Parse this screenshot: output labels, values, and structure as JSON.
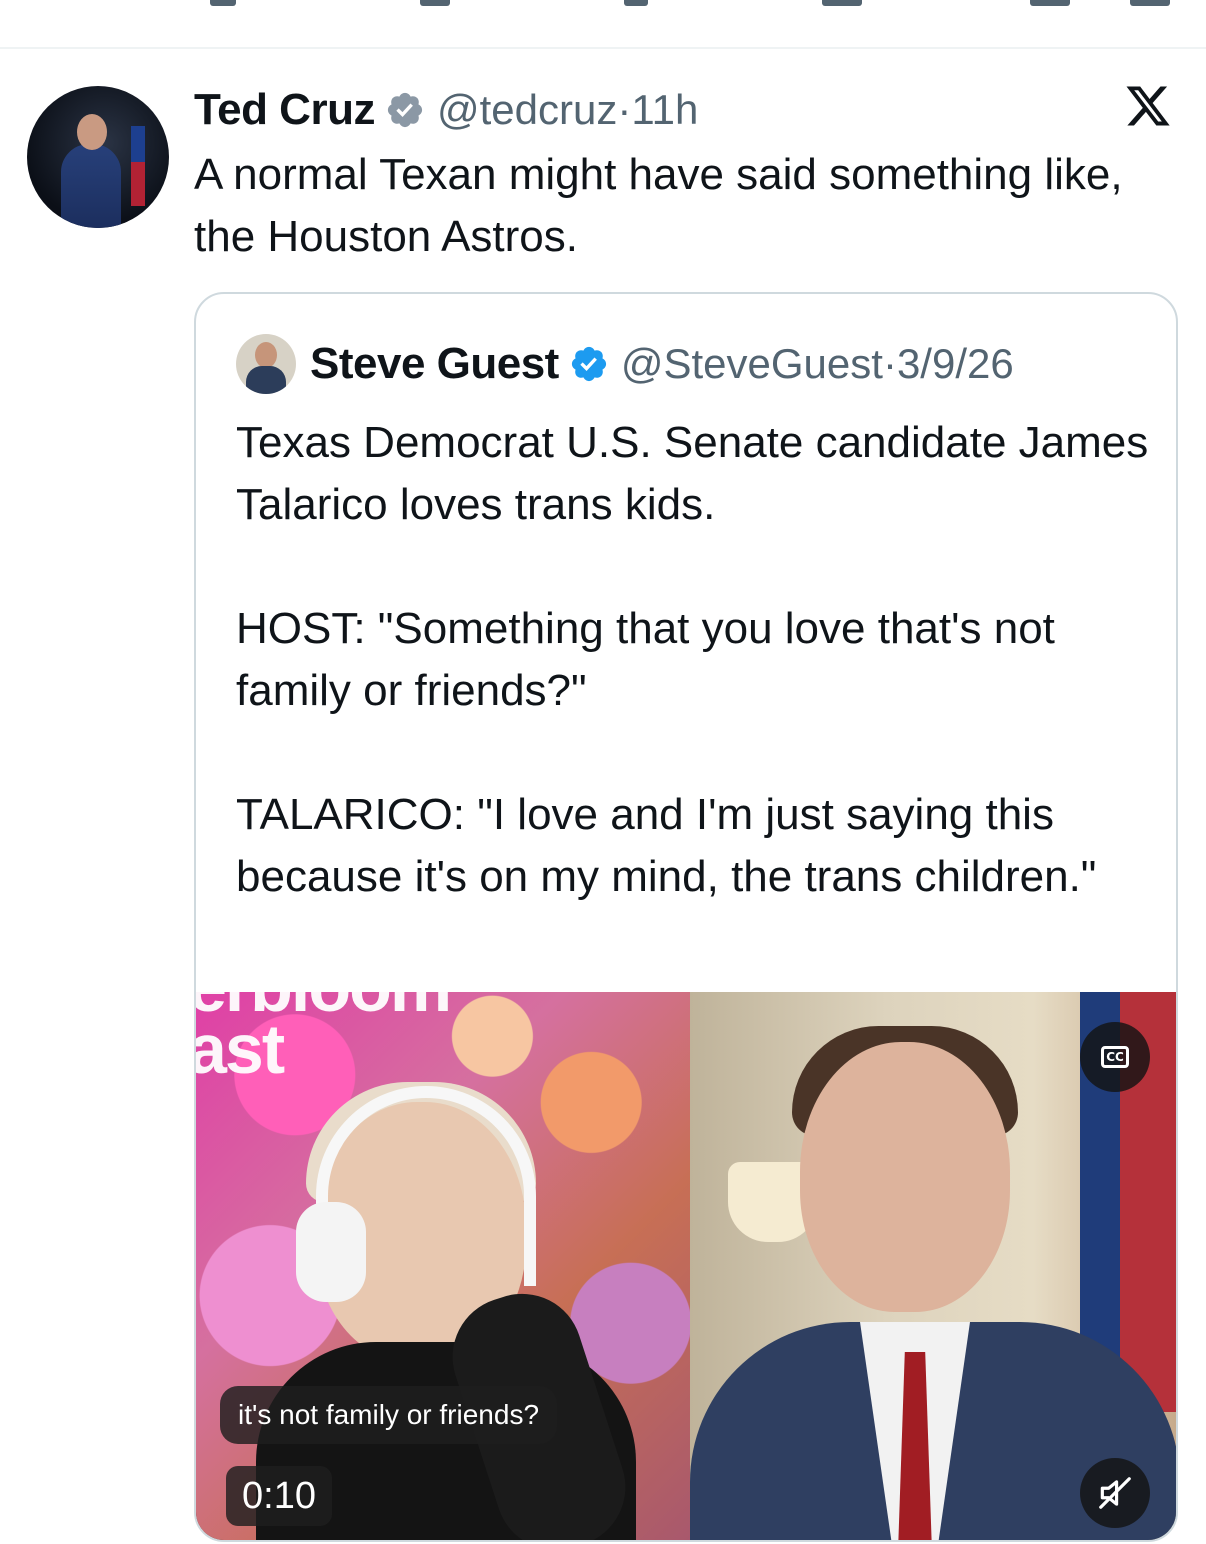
{
  "tweet": {
    "author_name": "Ted Cruz",
    "handle": "@tedcruz",
    "separator": " · ",
    "time": "11h",
    "text": "A normal Texan might have said something like, the Houston Astros."
  },
  "quoted_tweet": {
    "author_name": "Steve Guest",
    "handle": "@SteveGuest",
    "separator": " · ",
    "date": "3/9/26",
    "text": "Texas Democrat U.S. Senate candidate James Talarico loves trans kids.\n\nHOST: \"Something that you love that's not family or friends?\"\n\nTALARICO: \"I love and I'm just saying this because it's on my mind, the trans children.\""
  },
  "video": {
    "overlay_text": "erbloom\nast",
    "caption": "it's not family or friends?",
    "timestamp": "0:10",
    "cc_label": "CC"
  },
  "icons": {
    "verified": "verified-badge-icon",
    "x_logo": "x-logo-icon",
    "cc": "closed-captions-icon",
    "mute": "muted-speaker-icon"
  },
  "colors": {
    "verified": "#1d9bf0",
    "secondary_text": "#536471",
    "border": "#cfd9de"
  }
}
